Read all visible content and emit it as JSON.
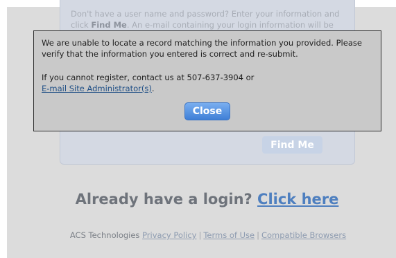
{
  "card": {
    "text_line1": "Don't have a user name and password? Enter your information and",
    "text_line2_pre": "click ",
    "text_line2_bold": "Find Me",
    "text_line2_post": ". An e-mail containing your login information will be",
    "find_me_label": "Find Me"
  },
  "modal": {
    "message": "We are unable to locate a record matching the information you provided. Please verify that the information you entered is correct and re-submit.",
    "contact_text": "If you cannot register, contact us at 507-637-3904 or",
    "admin_link": "E-mail Site Administrator(s)",
    "admin_suffix": ".",
    "close_label": "Close"
  },
  "login": {
    "text": "Already have a login? ",
    "link": "Click here"
  },
  "footer": {
    "company": "ACS Technologies ",
    "privacy": "Privacy Policy",
    "sep": "|",
    "terms": "Terms of Use",
    "browsers": "Compatible Browsers"
  }
}
